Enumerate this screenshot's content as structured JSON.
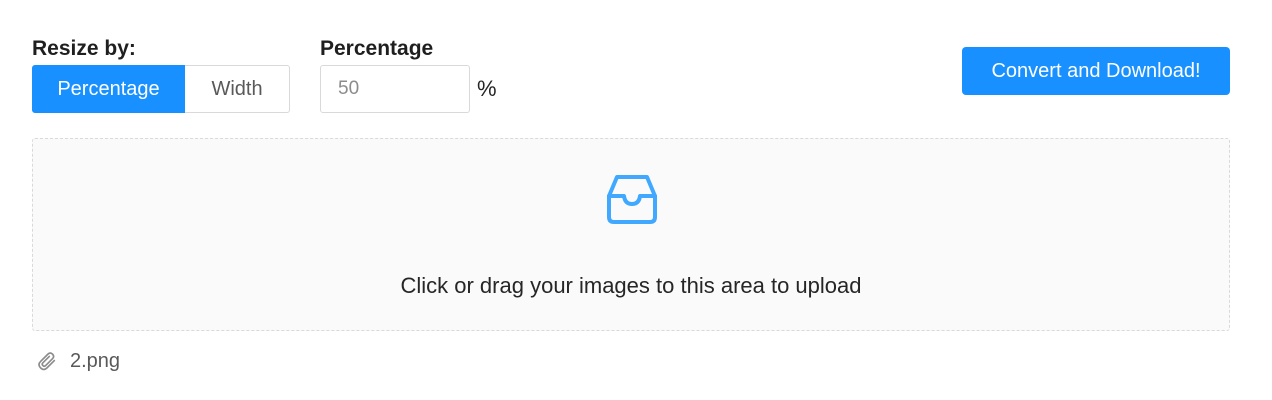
{
  "resize": {
    "label": "Resize by:",
    "options": [
      {
        "label": "Percentage",
        "selected": true
      },
      {
        "label": "Width",
        "selected": false
      }
    ]
  },
  "percentage": {
    "label": "Percentage",
    "placeholder": "50",
    "suffix": "%"
  },
  "convert_button": {
    "label": "Convert and Download!"
  },
  "upload": {
    "icon": "inbox-icon",
    "text": "Click or drag your images to this area to upload"
  },
  "files": [
    {
      "icon": "paperclip-icon",
      "name": "2.png"
    }
  ],
  "colors": {
    "accent": "#1890ff",
    "border": "#d9d9d9",
    "dropzone_bg": "#fafafa"
  }
}
